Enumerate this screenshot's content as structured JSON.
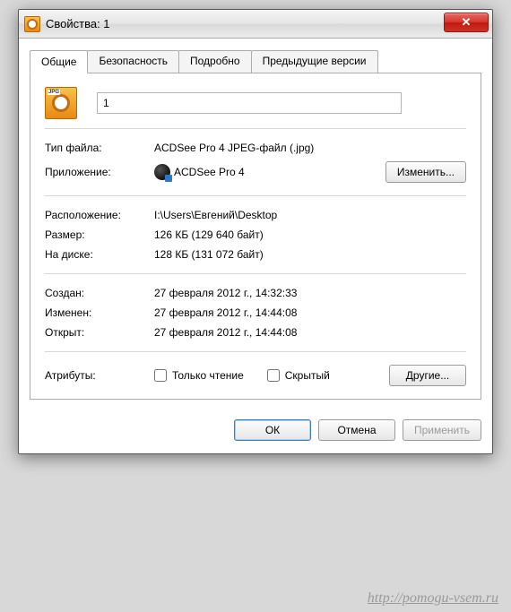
{
  "window": {
    "title": "Свойства: 1"
  },
  "tabs": [
    "Общие",
    "Безопасность",
    "Подробно",
    "Предыдущие версии"
  ],
  "file": {
    "name": "1"
  },
  "fields": {
    "filetype_label": "Тип файла:",
    "filetype_value": "ACDSee Pro 4 JPEG-файл (.jpg)",
    "app_label": "Приложение:",
    "app_value": "ACDSee Pro 4",
    "change_btn": "Изменить...",
    "location_label": "Расположение:",
    "location_value": "I:\\Users\\Евгений\\Desktop",
    "size_label": "Размер:",
    "size_value": "126 КБ (129 640 байт)",
    "sizeondisk_label": "На диске:",
    "sizeondisk_value": "128 КБ (131 072 байт)",
    "created_label": "Создан:",
    "created_value": "27 февраля 2012 г., 14:32:33",
    "modified_label": "Изменен:",
    "modified_value": "27 февраля 2012 г., 14:44:08",
    "accessed_label": "Открыт:",
    "accessed_value": "27 февраля 2012 г., 14:44:08",
    "attributes_label": "Атрибуты:",
    "readonly_label": "Только чтение",
    "hidden_label": "Скрытый",
    "other_btn": "Другие..."
  },
  "buttons": {
    "ok": "ОК",
    "cancel": "Отмена",
    "apply": "Применить"
  },
  "watermark": "http://pomogu-vsem.ru"
}
